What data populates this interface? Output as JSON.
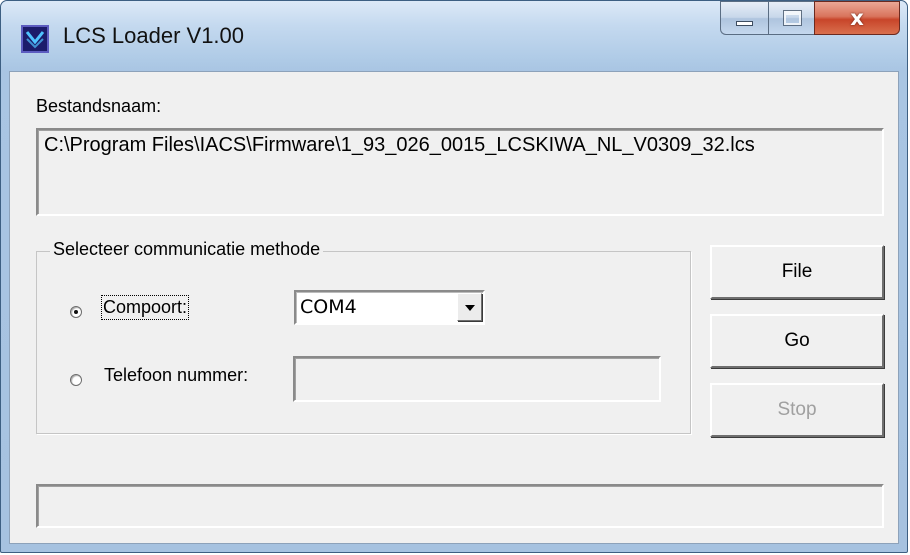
{
  "window": {
    "title": "LCS Loader V1.00"
  },
  "caption": {
    "close_glyph": "x"
  },
  "file": {
    "label": "Bestandsnaam:",
    "path": "C:\\Program Files\\IACS\\Firmware\\1_93_026_0015_LCSKIWA_NL_V0309_32.lcs"
  },
  "comm": {
    "group_title": "Selecteer communicatie methode",
    "compoort_label": "Compoort:",
    "compoort_selected": true,
    "com_port_value": "COM4",
    "phone_label": "Telefoon nummer:",
    "phone_selected": false,
    "phone_value": ""
  },
  "buttons": {
    "file": "File",
    "go": "Go",
    "stop": "Stop",
    "stop_enabled": false
  },
  "status": {
    "text": ""
  },
  "colors": {
    "title_gradient": "#c7dcf0",
    "client": "#f0f0f0",
    "close": "#c8452a"
  },
  "icons": {
    "app": "lcs-loader-app-icon",
    "minimize": "minimize-icon",
    "maximize": "maximize-icon",
    "close": "close-icon",
    "dropdown": "chevron-down-icon"
  }
}
